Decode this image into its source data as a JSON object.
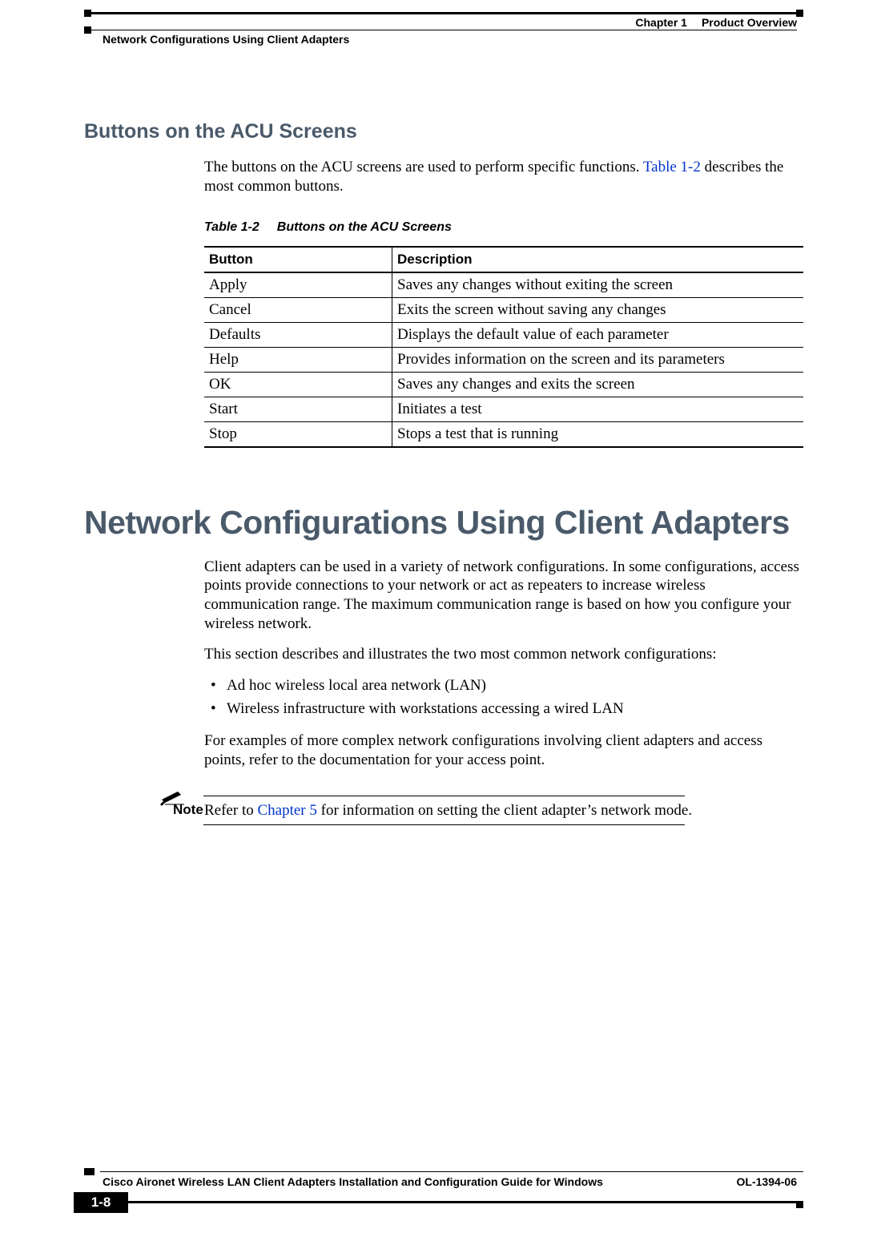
{
  "header": {
    "chapter_num": "Chapter 1",
    "chapter_title": "Product Overview",
    "section_title": "Network Configurations Using Client Adapters"
  },
  "section1": {
    "heading": "Buttons on the ACU Screens",
    "intro_pre": "The buttons on the ACU screens are used to perform specific functions. ",
    "intro_link": "Table 1-2",
    "intro_post": " describes the most common buttons."
  },
  "table": {
    "caption_num": "Table 1-2",
    "caption_title": "Buttons on the ACU Screens",
    "col1": "Button",
    "col2": "Description",
    "rows": [
      {
        "b": "Apply",
        "d": "Saves any changes without exiting the screen"
      },
      {
        "b": "Cancel",
        "d": "Exits the screen without saving any changes"
      },
      {
        "b": "Defaults",
        "d": "Displays the default value of each parameter"
      },
      {
        "b": "Help",
        "d": "Provides information on the screen and its parameters"
      },
      {
        "b": "OK",
        "d": "Saves any changes and exits the screen"
      },
      {
        "b": "Start",
        "d": "Initiates a test"
      },
      {
        "b": "Stop",
        "d": "Stops a test that is running"
      }
    ]
  },
  "section2": {
    "heading": "Network Configurations Using Client Adapters",
    "p1": "Client adapters can be used in a variety of network configurations. In some configurations, access points provide connections to your network or act as repeaters to increase wireless communication range. The maximum communication range is based on how you configure your wireless network.",
    "p2": "This section describes and illustrates the two most common network configurations:",
    "bullets": [
      "Ad hoc wireless local area network (LAN)",
      "Wireless infrastructure with workstations accessing a wired LAN"
    ],
    "p3": "For examples of more complex network configurations involving client adapters and access points, refer to the documentation for your access point."
  },
  "note": {
    "label": "Note",
    "text_pre": "Refer to ",
    "link": "Chapter 5",
    "text_post": " for information on setting the client adapter’s network mode."
  },
  "footer": {
    "guide": "Cisco Aironet Wireless LAN Client Adapters Installation and Configuration Guide for Windows",
    "pagenum": "1-8",
    "docnum": "OL-1394-06"
  }
}
